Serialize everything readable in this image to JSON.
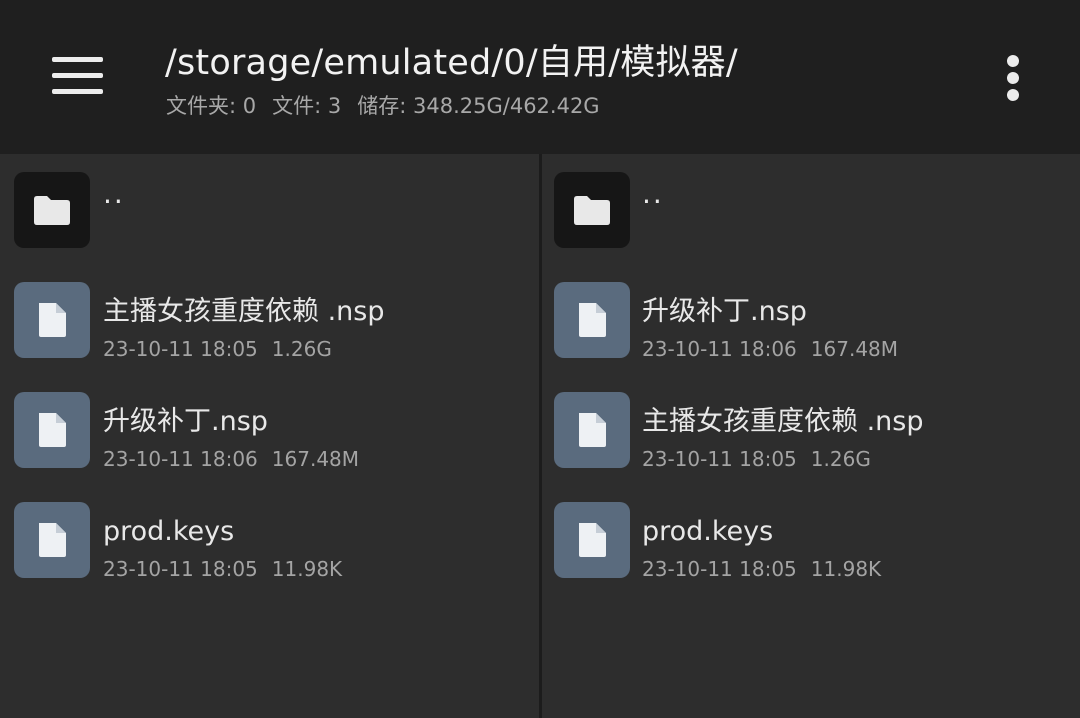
{
  "header": {
    "menu_icon": "hamburger-menu-icon",
    "path": "/storage/emulated/0/自用/模拟器/",
    "stats": {
      "folders": "文件夹: 0",
      "files": "文件: 3",
      "storage": "储存: 348.25G/462.42G"
    },
    "overflow_icon": "more-vertical-icon"
  },
  "colors": {
    "topbar": "#1f1f1f",
    "pane": "#2d2d2d",
    "folder_tile": "#161616",
    "file_tile": "#5a6b7e"
  },
  "left_pane": {
    "items": [
      {
        "name": "..",
        "date": "",
        "size": "",
        "icon": "folder-icon"
      },
      {
        "name": "主播女孩重度依赖 .nsp",
        "date": "23-10-11 18:05",
        "size": "1.26G",
        "icon": "file-icon"
      },
      {
        "name": "升级补丁.nsp",
        "date": "23-10-11 18:06",
        "size": "167.48M",
        "icon": "file-icon"
      },
      {
        "name": "prod.keys",
        "date": "23-10-11 18:05",
        "size": "11.98K",
        "icon": "file-icon"
      }
    ]
  },
  "right_pane": {
    "items": [
      {
        "name": "..",
        "date": "",
        "size": "",
        "icon": "folder-icon"
      },
      {
        "name": "升级补丁.nsp",
        "date": "23-10-11 18:06",
        "size": "167.48M",
        "icon": "file-icon"
      },
      {
        "name": "主播女孩重度依赖 .nsp",
        "date": "23-10-11 18:05",
        "size": "1.26G",
        "icon": "file-icon"
      },
      {
        "name": "prod.keys",
        "date": "23-10-11 18:05",
        "size": "11.98K",
        "icon": "file-icon"
      }
    ]
  }
}
